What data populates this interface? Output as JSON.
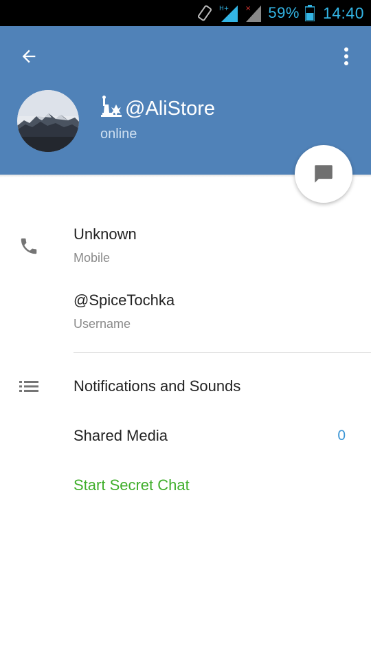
{
  "status_bar": {
    "network_type": "H+",
    "battery_percent": "59%",
    "time": "14:40"
  },
  "header": {
    "name": "@AliStore",
    "status": "online",
    "background_color": "#5082b8"
  },
  "contact_info": {
    "phone_value": "Unknown",
    "phone_label": "Mobile",
    "username_value": "@SpiceTochka",
    "username_label": "Username"
  },
  "settings": {
    "notifications_label": "Notifications and Sounds",
    "shared_media_label": "Shared Media",
    "shared_media_count": "0",
    "secret_chat_label": "Start Secret Chat"
  },
  "icons": {
    "back": "arrow-left-icon",
    "menu": "more-vertical-icon",
    "chat": "chat-bubble-icon",
    "phone": "phone-icon",
    "list": "list-icon"
  },
  "colors": {
    "accent_blue": "#3a95d5",
    "secret_green": "#3fae2a"
  }
}
